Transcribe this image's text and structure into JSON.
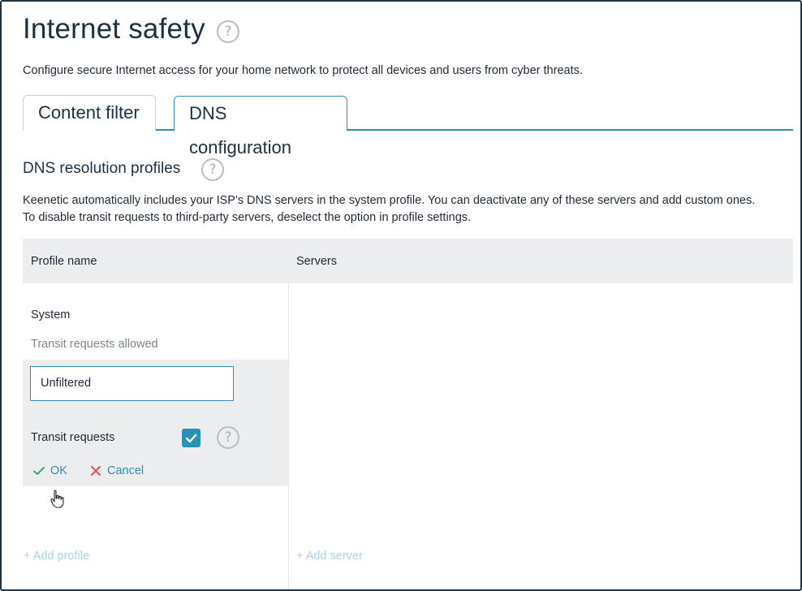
{
  "page": {
    "title": "Internet safety",
    "description": "Configure secure Internet access for your home network to protect all devices and users from cyber threats."
  },
  "tabs": [
    {
      "label": "Content filter",
      "active": false
    },
    {
      "label": "DNS configuration",
      "active": true
    }
  ],
  "section": {
    "title": "DNS resolution profiles",
    "description_line1": "Keenetic automatically includes your ISP's DNS servers in the system profile. You can deactivate any of these servers and add custom ones.",
    "description_line2": "To disable transit requests to third-party servers, deselect the option in profile settings."
  },
  "table": {
    "columns": [
      "Profile name",
      "Servers"
    ],
    "profiles": [
      {
        "name": "System",
        "status": "Transit requests allowed"
      }
    ]
  },
  "edit_form": {
    "name_value": "Unfiltered",
    "transit_label": "Transit requests",
    "transit_checked": true,
    "ok_label": "OK",
    "cancel_label": "Cancel"
  },
  "add_profile_label": "+ Add profile",
  "add_server_label": "+ Add server",
  "icons": {
    "help": "question-circle-icon",
    "check": "check-icon",
    "close": "close-icon",
    "cursor": "hand-pointer-icon"
  },
  "colors": {
    "accent": "#2b8fb8",
    "ok_check": "#3aa76d",
    "cancel_x": "#e0554f",
    "muted_link": "#a9d4e6"
  }
}
